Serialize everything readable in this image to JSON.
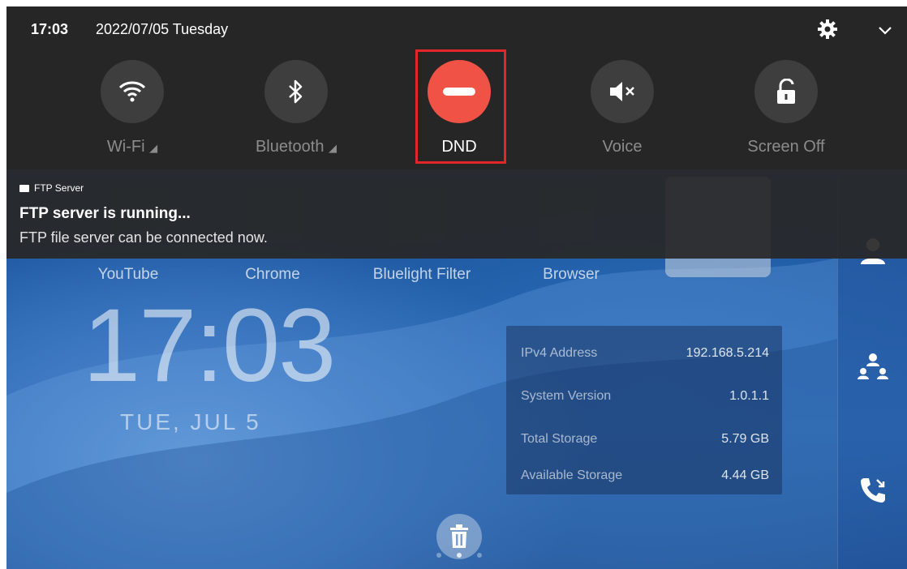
{
  "status_bar": {
    "time": "17:03",
    "date": "2022/07/05 Tuesday"
  },
  "quick_tiles": [
    {
      "label": "Wi-Fi",
      "icon": "wifi-icon"
    },
    {
      "label": "Bluetooth",
      "icon": "bluetooth-icon"
    },
    {
      "label": "DND",
      "icon": "dnd-icon"
    },
    {
      "label": "Voice",
      "icon": "volume-mute-icon"
    },
    {
      "label": "Screen Off",
      "icon": "lock-icon"
    }
  ],
  "notification": {
    "app": "FTP Server",
    "title": "FTP server is running...",
    "body": "FTP file server can be connected now."
  },
  "apps": [
    "YouTube",
    "Chrome",
    "Bluelight Filter",
    "Browser"
  ],
  "clock": {
    "time": "17:03",
    "date": "TUE, JUL 5"
  },
  "info": [
    {
      "label": "IPv4 Address",
      "value": "192.168.5.214"
    },
    {
      "label": "System Version",
      "value": "1.0.1.1"
    },
    {
      "label": "Total Storage",
      "value": "5.79 GB"
    },
    {
      "label": "Available Storage",
      "value": "4.44 GB"
    }
  ],
  "colors": {
    "dnd_accent": "#f05245",
    "highlight": "#e3262c",
    "panel": "#262626"
  }
}
